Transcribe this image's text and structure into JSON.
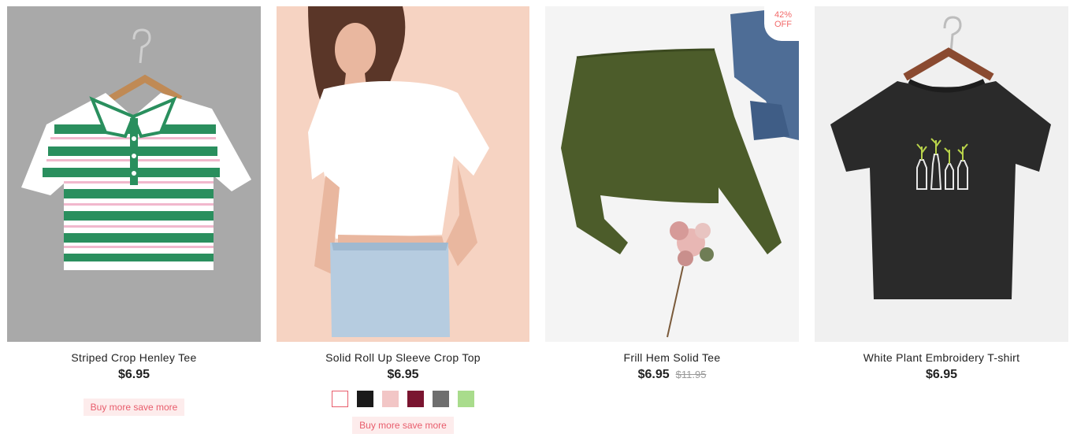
{
  "products": [
    {
      "name": "Striped Crop Henley Tee",
      "price": "$6.95",
      "promo": "Buy more save more"
    },
    {
      "name": "Solid Roll Up Sleeve Crop Top",
      "price": "$6.95",
      "promo": "Buy more save more",
      "swatches": [
        "#ffffff",
        "#1a1a1a",
        "#f2c6c6",
        "#7a1530",
        "#6e6e6e",
        "#a9dc8c"
      ],
      "selected_swatch": 0
    },
    {
      "name": "Frill Hem Solid Tee",
      "price": "$6.95",
      "old_price": "$11.95",
      "discount_pct": "42%",
      "discount_off": "OFF"
    },
    {
      "name": "White Plant Embroidery T-shirt",
      "price": "$6.95"
    }
  ],
  "colors": {
    "accent": "#e85d6c",
    "promo_bg": "#fdecec",
    "discount_text": "#f26a6a"
  }
}
